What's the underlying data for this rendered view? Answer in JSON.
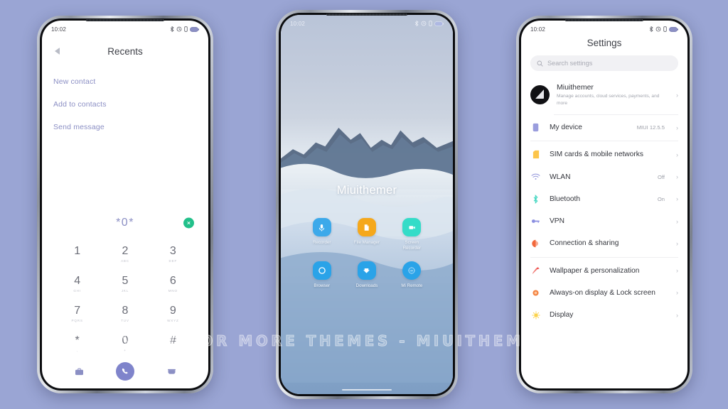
{
  "background_color": "#9aa5d4",
  "watermark": "VISIT FOR MORE THEMES - MIUITHEMER.COM",
  "phone1": {
    "status": {
      "time": "10:02",
      "icons": [
        "bluetooth-icon",
        "alarm-icon",
        "vibrate-icon",
        "battery-icon"
      ]
    },
    "header": {
      "back": "back-arrow",
      "title": "Recents"
    },
    "actions": [
      {
        "label": "New contact"
      },
      {
        "label": "Add to contacts"
      },
      {
        "label": "Send message"
      }
    ],
    "dial": {
      "number": "*0*",
      "delete_icon": "delete-icon",
      "delete_color": "#22c08a"
    },
    "keypad": [
      {
        "digit": "1",
        "letters": ""
      },
      {
        "digit": "2",
        "letters": "ABC"
      },
      {
        "digit": "3",
        "letters": "DEF"
      },
      {
        "digit": "4",
        "letters": "GHI"
      },
      {
        "digit": "5",
        "letters": "JKL"
      },
      {
        "digit": "6",
        "letters": "MNO"
      },
      {
        "digit": "7",
        "letters": "PQRS"
      },
      {
        "digit": "8",
        "letters": "TUV"
      },
      {
        "digit": "9",
        "letters": "WXYZ"
      },
      {
        "digit": "*",
        "letters": ","
      },
      {
        "digit": "0",
        "letters": "+"
      },
      {
        "digit": "#",
        "letters": ""
      }
    ],
    "bottom": {
      "left_icon": "contacts-icon",
      "call_icon": "call-icon",
      "call_color": "#7f84cb",
      "right_icon": "keypad-toggle-icon"
    }
  },
  "phone2": {
    "status": {
      "time": "10:02",
      "icons": [
        "bluetooth-icon",
        "alarm-icon",
        "vibrate-icon",
        "battery-icon"
      ]
    },
    "wallpaper_label": "Miuithemer",
    "apps": [
      {
        "label": "Recorder",
        "icon": "recorder-icon",
        "color": "#3ca9ea",
        "shape": "squircle"
      },
      {
        "label": "File Manager",
        "icon": "file-manager-icon",
        "color": "#f5a81c",
        "shape": "squircle"
      },
      {
        "label": "Screen Recorder",
        "icon": "screen-recorder-icon",
        "color": "#34dcc8",
        "shape": "squircle"
      },
      {
        "label": "Browser",
        "icon": "browser-icon",
        "color": "#2aa3e8",
        "shape": "squircle"
      },
      {
        "label": "Downloads",
        "icon": "downloads-icon",
        "color": "#2aa3e8",
        "shape": "squircle"
      },
      {
        "label": "Mi Remote",
        "icon": "mi-remote-icon",
        "color": "#2aa3e8",
        "shape": "squircle"
      }
    ]
  },
  "phone3": {
    "status": {
      "time": "10:02",
      "icons": [
        "bluetooth-icon",
        "alarm-icon",
        "vibrate-icon",
        "battery-icon"
      ]
    },
    "title": "Settings",
    "search": {
      "placeholder": "Search settings",
      "icon": "search-icon"
    },
    "account": {
      "name": "Miuithemer",
      "subtitle": "Manage accounts, cloud services, payments, and more",
      "avatar": "user-avatar"
    },
    "items": [
      {
        "label": "My device",
        "value": "MIUI 12.5.5",
        "icon": "device-icon",
        "color": "#9a9ddd"
      },
      {
        "label": "SIM cards & mobile networks",
        "value": "",
        "icon": "sim-card-icon",
        "color": "#fcc54a"
      },
      {
        "label": "WLAN",
        "value": "Off",
        "icon": "wifi-icon",
        "color": "#9a9ddd"
      },
      {
        "label": "Bluetooth",
        "value": "On",
        "icon": "bluetooth-icon",
        "color": "#3fd6c0"
      },
      {
        "label": "VPN",
        "value": "",
        "icon": "vpn-key-icon",
        "color": "#8b8fe0"
      },
      {
        "label": "Connection & sharing",
        "value": "",
        "icon": "connection-sharing-icon",
        "color": "#f2683c"
      },
      {
        "label": "Wallpaper & personalization",
        "value": "",
        "icon": "wallpaper-icon",
        "color": "#ef5350"
      },
      {
        "label": "Always-on display & Lock screen",
        "value": "",
        "icon": "aod-lock-icon",
        "color": "#f4813f"
      },
      {
        "label": "Display",
        "value": "",
        "icon": "display-brightness-icon",
        "color": "#fbd34d"
      }
    ]
  }
}
